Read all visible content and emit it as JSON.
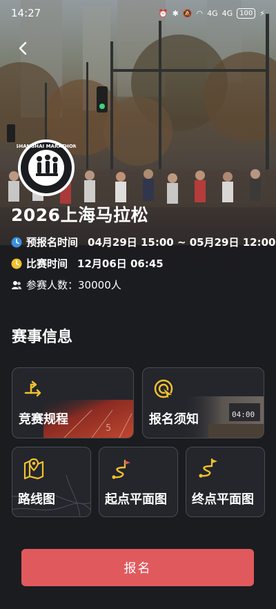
{
  "status_bar": {
    "time": "14:27",
    "network_1": "4G",
    "network_2": "4G",
    "battery": "100"
  },
  "event": {
    "title": "2026上海马拉松",
    "logo_text": "SHANGHAI MARATHON"
  },
  "info": {
    "prereg_label": "预报名时间",
    "prereg_value": "04月29日 15:00 ~ 05月29日 12:00",
    "race_label": "比赛时间",
    "race_value": "12月06日 06:45",
    "participants_label": "参赛人数：",
    "participants_value": "30000人"
  },
  "section": {
    "title": "赛事信息"
  },
  "cards": {
    "rules": "竞赛规程",
    "notice": "报名须知",
    "route": "路线图",
    "start": "起点平面图",
    "finish": "终点平面图"
  },
  "signup_button": "报名",
  "colors": {
    "accent_red": "#e05a5d",
    "icon_yellow": "#f2c12e",
    "clock_blue": "#3a8fe0",
    "background": "#1b1c20"
  }
}
